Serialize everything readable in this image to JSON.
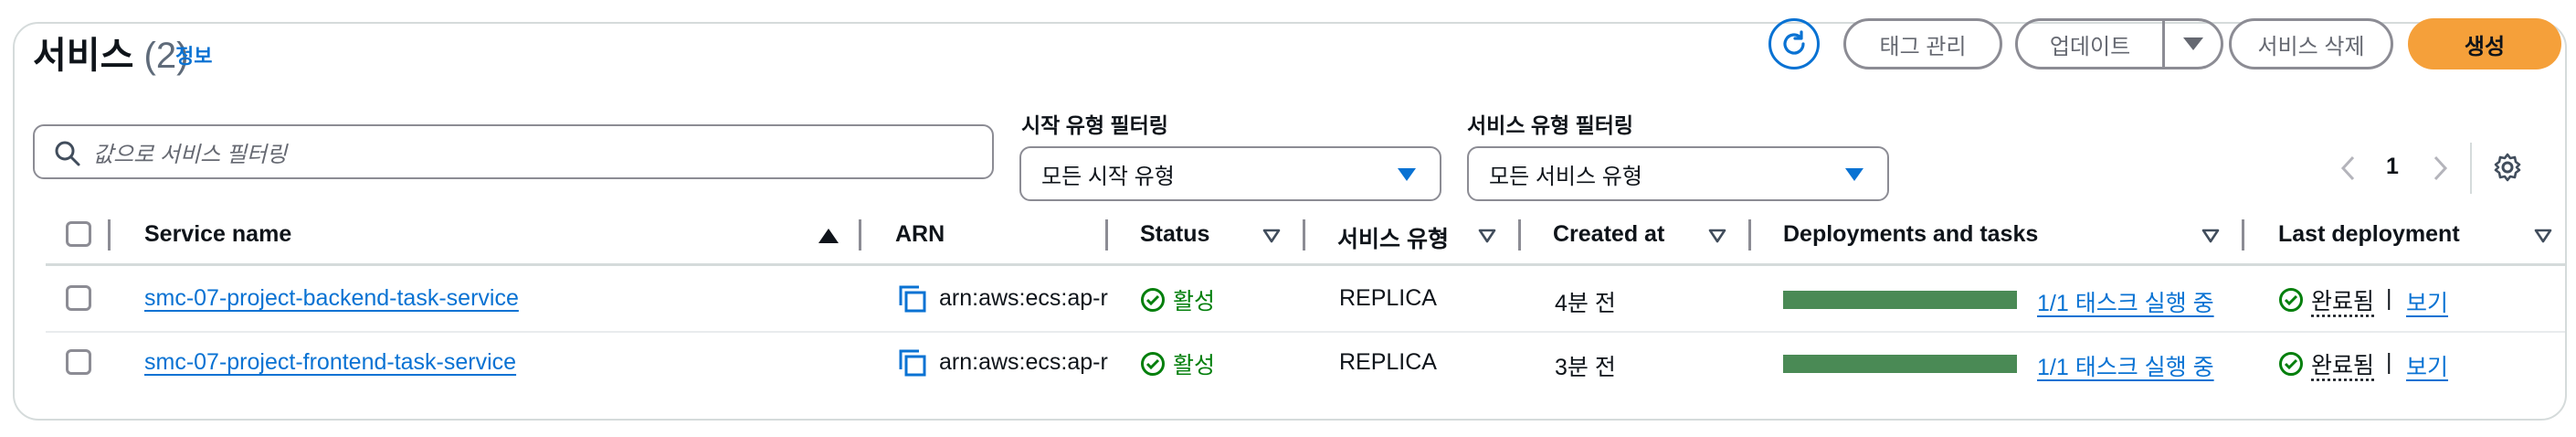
{
  "header": {
    "title": "서비스",
    "count": "(2)",
    "info_link": "정보"
  },
  "actions": {
    "refresh_icon": "refresh-icon",
    "manage_tags": "태그 관리",
    "update": "업데이트",
    "delete_service": "서비스 삭제",
    "create": "생성"
  },
  "filters": {
    "search_placeholder": "값으로 서비스 필터링",
    "launch_type_label": "시작 유형 필터링",
    "launch_type_value": "모든 시작 유형",
    "service_type_label": "서비스 유형 필터링",
    "service_type_value": "모든 서비스 유형"
  },
  "pagination": {
    "current_page": "1"
  },
  "table": {
    "columns": {
      "service_name": "Service name",
      "arn": "ARN",
      "status": "Status",
      "service_type": "서비스 유형",
      "created_at": "Created at",
      "deployments": "Deployments and tasks",
      "last_deployment": "Last deployment"
    },
    "rows": [
      {
        "service_name": "smc-07-project-backend-task-service",
        "arn": "arn:aws:ecs:ap-r",
        "status": "활성",
        "service_type": "REPLICA",
        "created_at": "4분 전",
        "tasks": "1/1 태스크 실행 중",
        "tasks_progress": 1.0,
        "last_deployment": "완료됨",
        "view": "보기"
      },
      {
        "service_name": "smc-07-project-frontend-task-service",
        "arn": "arn:aws:ecs:ap-r",
        "status": "활성",
        "service_type": "REPLICA",
        "created_at": "3분 전",
        "tasks": "1/1 태스크 실행 중",
        "tasks_progress": 1.0,
        "last_deployment": "완료됨",
        "view": "보기"
      }
    ]
  },
  "colors": {
    "primary": "#f5a03a",
    "link": "#0972d3",
    "success": "#037f0c",
    "progress": "#4a8a55"
  }
}
